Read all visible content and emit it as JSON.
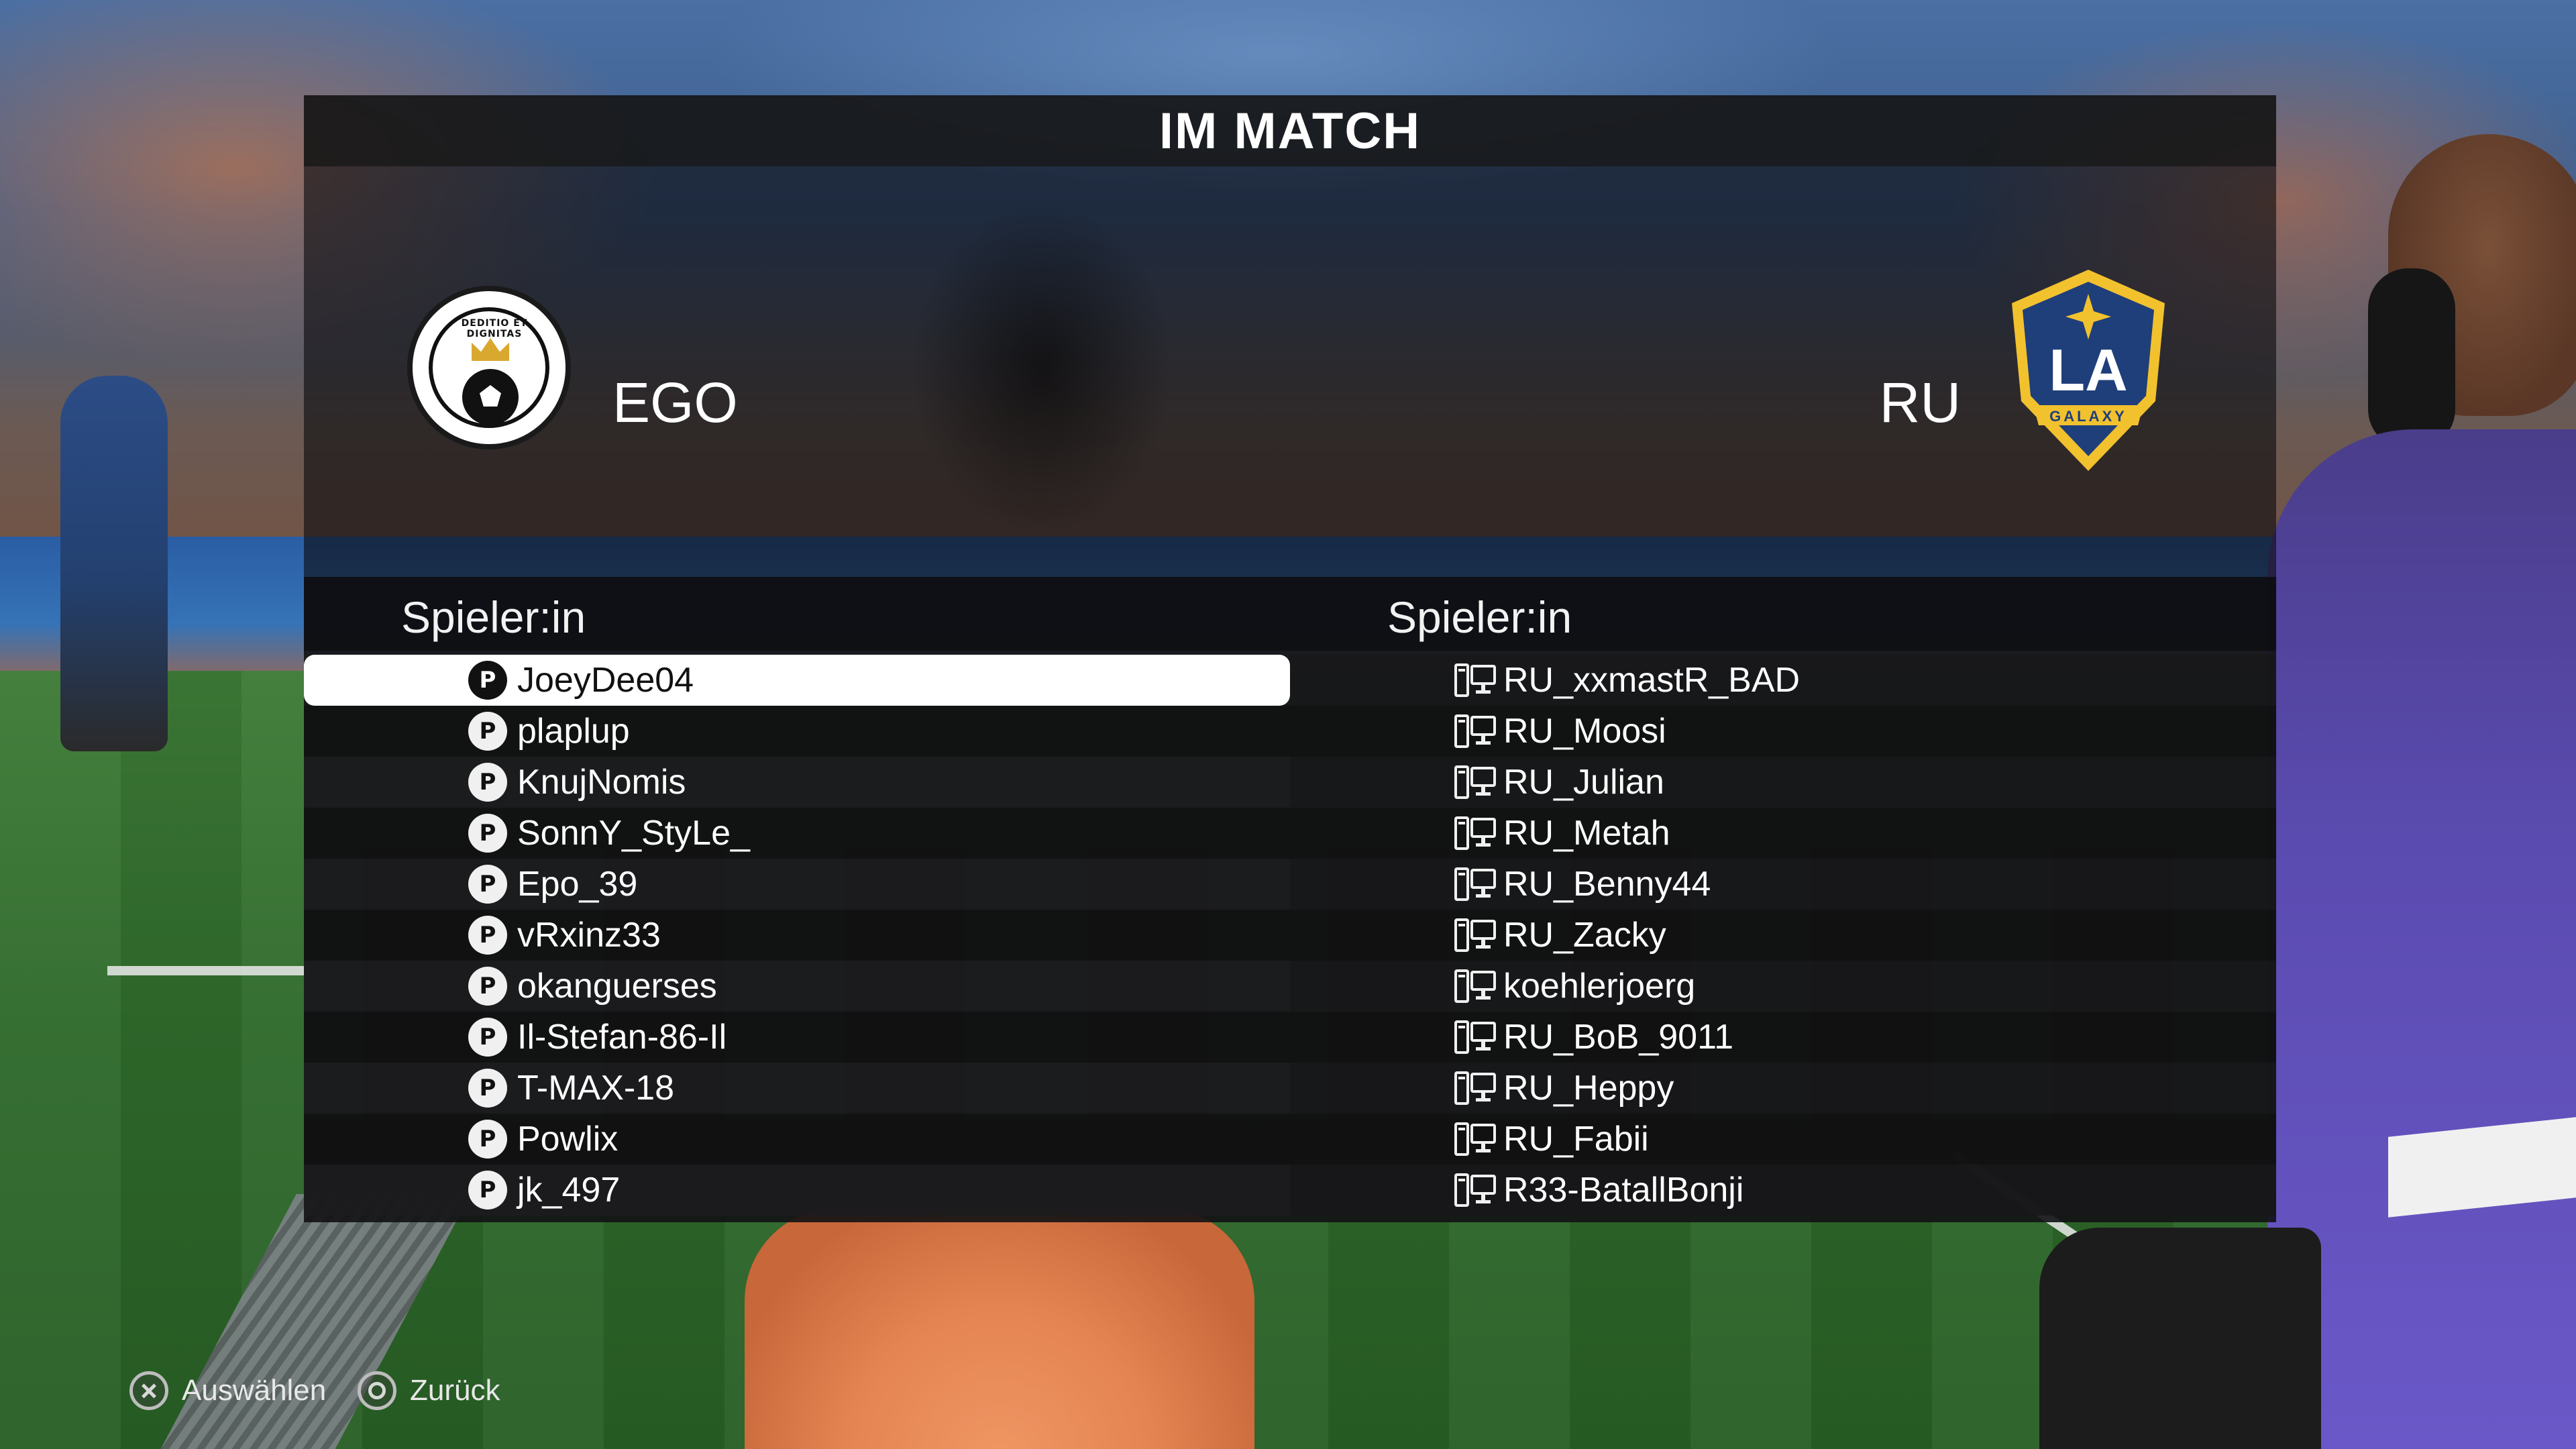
{
  "title": "IM MATCH",
  "home_team": {
    "name": "EGO",
    "crest_icon": "deditio-et-dignitas-crest-icon",
    "crest_text": "DEDITIO ET DIGNITAS",
    "platform_icon": "playstation-icon"
  },
  "away_team": {
    "name": "RU",
    "crest_icon": "la-galaxy-crest-icon",
    "crest_text": "LA",
    "crest_subtext": "GALAXY",
    "platform_icon": "pc-icon"
  },
  "home_list": {
    "header": "Spieler:in",
    "selected_index": 0,
    "players": [
      "JoeyDee04",
      "plaplup",
      "KnujNomis",
      "SonnY_StyLe_",
      "Epo_39",
      "vRxinz33",
      "okanguerses",
      "Il-Stefan-86-Il",
      "T-MAX-18",
      "Powlix",
      "jk_497"
    ]
  },
  "away_list": {
    "header": "Spieler:in",
    "players": [
      "RU_xxmastR_BAD",
      "RU_Moosi",
      "RU_Julian",
      "RU_Metah",
      "RU_Benny44",
      "RU_Zacky",
      "koehlerjoerg",
      "RU_BoB_9011",
      "RU_Heppy",
      "RU_Fabii",
      "R33-BatallBonji"
    ]
  },
  "hints": {
    "select": "Auswählen",
    "back": "Zurück"
  },
  "colors": {
    "selected_row": "#ffffff",
    "galaxy_navy": "#1f3f7a",
    "galaxy_gold": "#f2c12e",
    "crown_gold": "#d9a82e"
  }
}
